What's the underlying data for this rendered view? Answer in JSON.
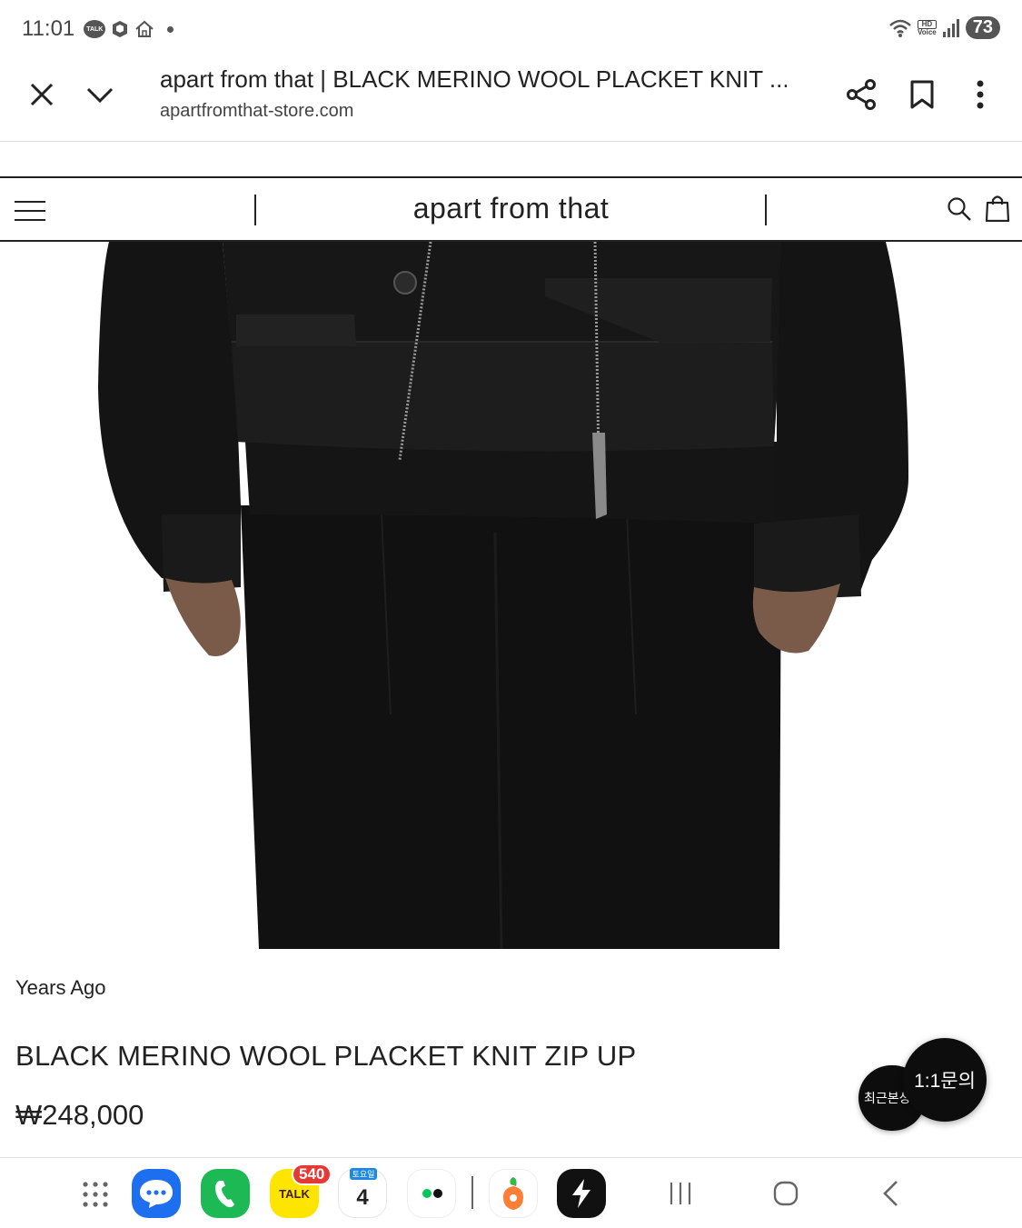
{
  "status_bar": {
    "time": "11:01",
    "talk_label": "TALK",
    "hd_label": "HD",
    "voice_label": "Voice",
    "battery": "73"
  },
  "browser": {
    "title": "apart from that | BLACK MERINO WOOL PLACKET KNIT ...",
    "url": "apartfromthat-store.com"
  },
  "site": {
    "logo": "apart from that"
  },
  "product": {
    "brand": "Years Ago",
    "name": "BLACK MERINO WOOL PLACKET KNIT ZIP UP",
    "price": "₩248,000"
  },
  "floating": {
    "recent_label": "최근본상",
    "inquiry_label": "1:1문의"
  },
  "nav": {
    "kakaotalk_badge": "540",
    "kakaotalk_label": "TALK",
    "calendar_day_label": "토요일",
    "calendar_day": "4"
  },
  "colors": {
    "messages": "#1e6ff0",
    "phone": "#1db954",
    "kakao": "#fee500",
    "carrot": "#ff7e36",
    "garment": "#141414"
  }
}
